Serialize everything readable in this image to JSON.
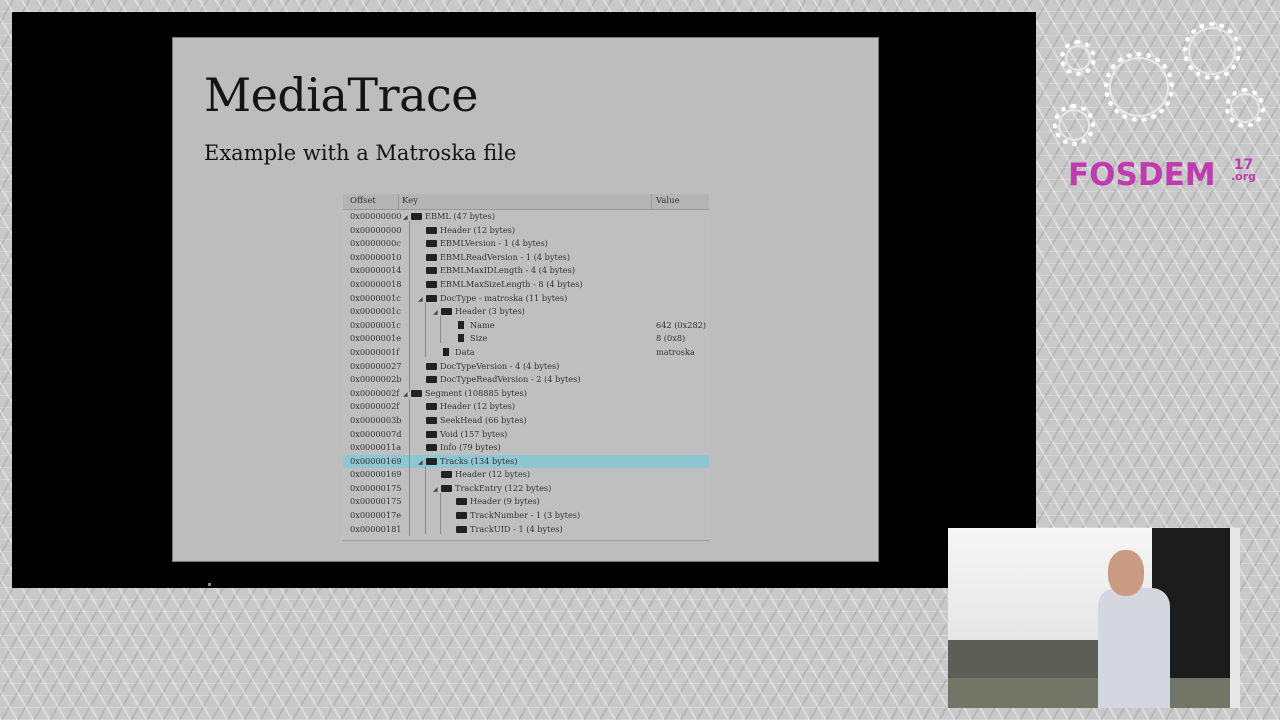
{
  "slide": {
    "title": "MediaTrace",
    "subtitle": "Example with a Matroska file"
  },
  "tree": {
    "headers": {
      "offset": "Offset",
      "key": "Key",
      "value": "Value"
    },
    "rows": [
      {
        "offset": "0x00000000",
        "key": "EBML (47 bytes)",
        "depth": 0,
        "type": "folder",
        "value": "",
        "selected": false
      },
      {
        "offset": "0x00000000",
        "key": "Header (12 bytes)",
        "depth": 1,
        "type": "folder",
        "value": "",
        "selected": false
      },
      {
        "offset": "0x0000000c",
        "key": "EBMLVersion - 1 (4 bytes)",
        "depth": 1,
        "type": "folder",
        "value": "",
        "selected": false
      },
      {
        "offset": "0x00000010",
        "key": "EBMLReadVersion - 1 (4 bytes)",
        "depth": 1,
        "type": "folder",
        "value": "",
        "selected": false
      },
      {
        "offset": "0x00000014",
        "key": "EBMLMaxIDLength - 4 (4 bytes)",
        "depth": 1,
        "type": "folder",
        "value": "",
        "selected": false
      },
      {
        "offset": "0x00000018",
        "key": "EBMLMaxSizeLength - 8 (4 bytes)",
        "depth": 1,
        "type": "folder",
        "value": "",
        "selected": false
      },
      {
        "offset": "0x0000001c",
        "key": "DocType - matroska (11 bytes)",
        "depth": 1,
        "type": "folder",
        "value": "",
        "selected": false
      },
      {
        "offset": "0x0000001c",
        "key": "Header (3 bytes)",
        "depth": 2,
        "type": "folder",
        "value": "",
        "selected": false
      },
      {
        "offset": "0x0000001c",
        "key": "Name",
        "depth": 3,
        "type": "file",
        "value": "642 (0x282)",
        "selected": false
      },
      {
        "offset": "0x0000001e",
        "key": "Size",
        "depth": 3,
        "type": "file",
        "value": "8 (0x8)",
        "selected": false
      },
      {
        "offset": "0x0000001f",
        "key": "Data",
        "depth": 2,
        "type": "file",
        "value": "matroska",
        "selected": false
      },
      {
        "offset": "0x00000027",
        "key": "DocTypeVersion - 4 (4 bytes)",
        "depth": 1,
        "type": "folder",
        "value": "",
        "selected": false
      },
      {
        "offset": "0x0000002b",
        "key": "DocTypeReadVersion - 2 (4 bytes)",
        "depth": 1,
        "type": "folder",
        "value": "",
        "selected": false
      },
      {
        "offset": "0x0000002f",
        "key": "Segment (108885 bytes)",
        "depth": 0,
        "type": "folder",
        "value": "",
        "selected": false
      },
      {
        "offset": "0x0000002f",
        "key": "Header (12 bytes)",
        "depth": 1,
        "type": "folder",
        "value": "",
        "selected": false
      },
      {
        "offset": "0x0000003b",
        "key": "SeekHead (66 bytes)",
        "depth": 1,
        "type": "folder",
        "value": "",
        "selected": false
      },
      {
        "offset": "0x0000007d",
        "key": "Void (157 bytes)",
        "depth": 1,
        "type": "folder",
        "value": "",
        "selected": false
      },
      {
        "offset": "0x0000011a",
        "key": "Info (79 bytes)",
        "depth": 1,
        "type": "folder",
        "value": "",
        "selected": false
      },
      {
        "offset": "0x00000169",
        "key": "Tracks (134 bytes)",
        "depth": 1,
        "type": "folder",
        "value": "",
        "selected": true
      },
      {
        "offset": "0x00000169",
        "key": "Header (12 bytes)",
        "depth": 2,
        "type": "folder",
        "value": "",
        "selected": false
      },
      {
        "offset": "0x00000175",
        "key": "TrackEntry (122 bytes)",
        "depth": 2,
        "type": "folder",
        "value": "",
        "selected": false
      },
      {
        "offset": "0x00000175",
        "key": "Header (9 bytes)",
        "depth": 3,
        "type": "folder",
        "value": "",
        "selected": false
      },
      {
        "offset": "0x0000017e",
        "key": "TrackNumber - 1 (3 bytes)",
        "depth": 3,
        "type": "folder",
        "value": "",
        "selected": false
      },
      {
        "offset": "0x00000181",
        "key": "TrackUID - 1 (4 bytes)",
        "depth": 3,
        "type": "folder",
        "value": "",
        "selected": false
      }
    ]
  },
  "logo": {
    "text": "FOSDEM",
    "edition": "17",
    "suffix": ".org",
    "accent_color": "#c03cae"
  },
  "icons": [
    "folder-icon",
    "file-icon",
    "expand-arrow-icon",
    "gear-icon"
  ]
}
